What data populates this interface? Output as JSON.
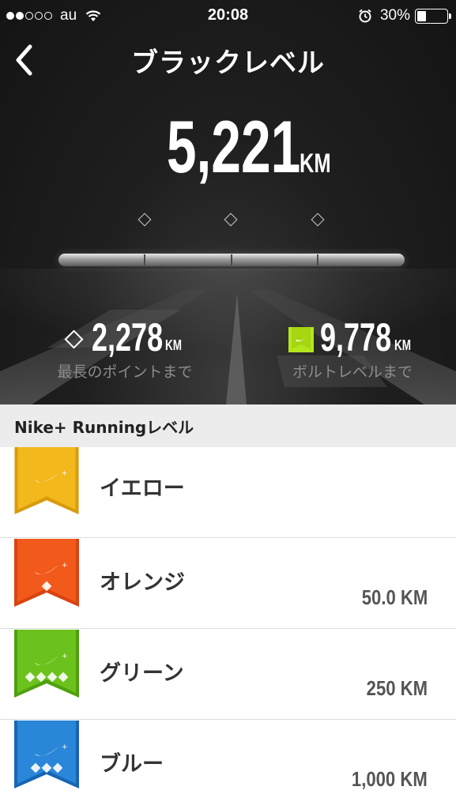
{
  "status_bar": {
    "carrier": "au",
    "time": "20:08",
    "battery_percent": "30%",
    "battery_level": 0.3,
    "signal_bars": 2,
    "icons": [
      "signal-dots-icon",
      "wifi-icon",
      "alarm-icon",
      "battery-icon"
    ]
  },
  "nav": {
    "title": "ブラックレベル",
    "back_icon": "chevron-left-icon"
  },
  "total_distance": {
    "value": "5,221",
    "unit": "KM"
  },
  "progress": {
    "position": 0.5
  },
  "stats": {
    "next_point": {
      "value": "2,278",
      "unit": "KM",
      "caption": "最長のポイントまで",
      "icon": "diamond-icon"
    },
    "next_level": {
      "value": "9,778",
      "unit": "KM",
      "caption": "ボルトレベルまで",
      "icon": "volt-badge-icon"
    }
  },
  "levels_section": {
    "title": "Nike+ Runningレベル",
    "levels": [
      {
        "name": "イエロー",
        "distance": "",
        "color": "#f2b81c",
        "color_dark": "#d89b0c",
        "points": 0
      },
      {
        "name": "オレンジ",
        "distance": "50.0 KM",
        "color": "#f25a1c",
        "color_dark": "#d9430f",
        "points": 1
      },
      {
        "name": "グリーン",
        "distance": "250 KM",
        "color": "#6cc21c",
        "color_dark": "#4fa00e",
        "points": 4
      },
      {
        "name": "ブルー",
        "distance": "1,000 KM",
        "color": "#2a86d8",
        "color_dark": "#1765b4",
        "points": 3
      }
    ]
  },
  "colors": {
    "hero_bg": "#1a1a1a",
    "volt": "#b5e61d",
    "caption": "#8c8c8c"
  }
}
